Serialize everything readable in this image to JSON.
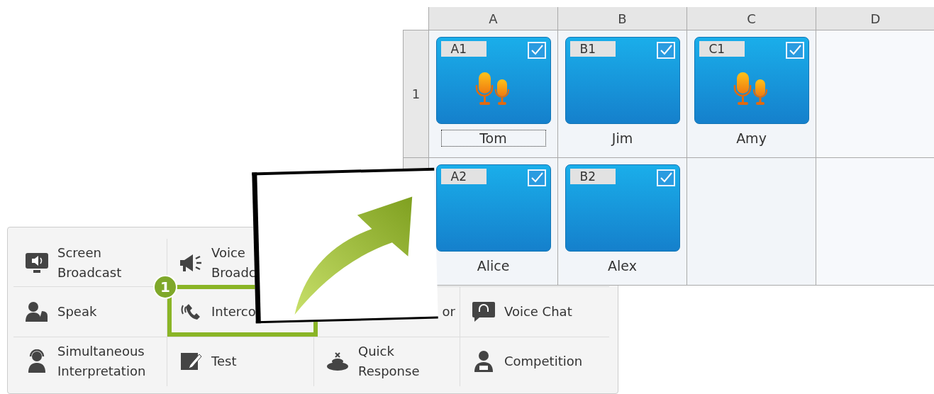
{
  "grid": {
    "columns": [
      "A",
      "B",
      "C",
      "D"
    ],
    "rows": [
      {
        "header": "1",
        "tiles": [
          {
            "code": "A1",
            "name": "Tom",
            "checked": true,
            "speaking": true,
            "focused": true
          },
          {
            "code": "B1",
            "name": "Jim",
            "checked": true,
            "speaking": false,
            "focused": false
          },
          {
            "code": "C1",
            "name": "Amy",
            "checked": true,
            "speaking": true,
            "focused": false
          }
        ]
      },
      {
        "tiles": [
          {
            "code": "A2",
            "name": "Alice",
            "checked": true,
            "speaking": false,
            "focused": false
          },
          {
            "code": "B2",
            "name": "Alex",
            "checked": true,
            "speaking": false,
            "focused": false
          }
        ]
      }
    ]
  },
  "menu": {
    "rows": [
      [
        {
          "label": "Screen\nBroadcast"
        },
        {
          "label": "Voice\nBroadc"
        }
      ],
      [
        {
          "label": "Speak"
        },
        {
          "label": "Interco",
          "callout": "1"
        },
        {
          "label": "or"
        },
        {
          "label": "Voice Chat"
        }
      ],
      [
        {
          "label": "Simultaneous\nInterpretation"
        },
        {
          "label": "Test"
        },
        {
          "label": "Quick\nResponse"
        },
        {
          "label": "Competition"
        }
      ]
    ]
  }
}
